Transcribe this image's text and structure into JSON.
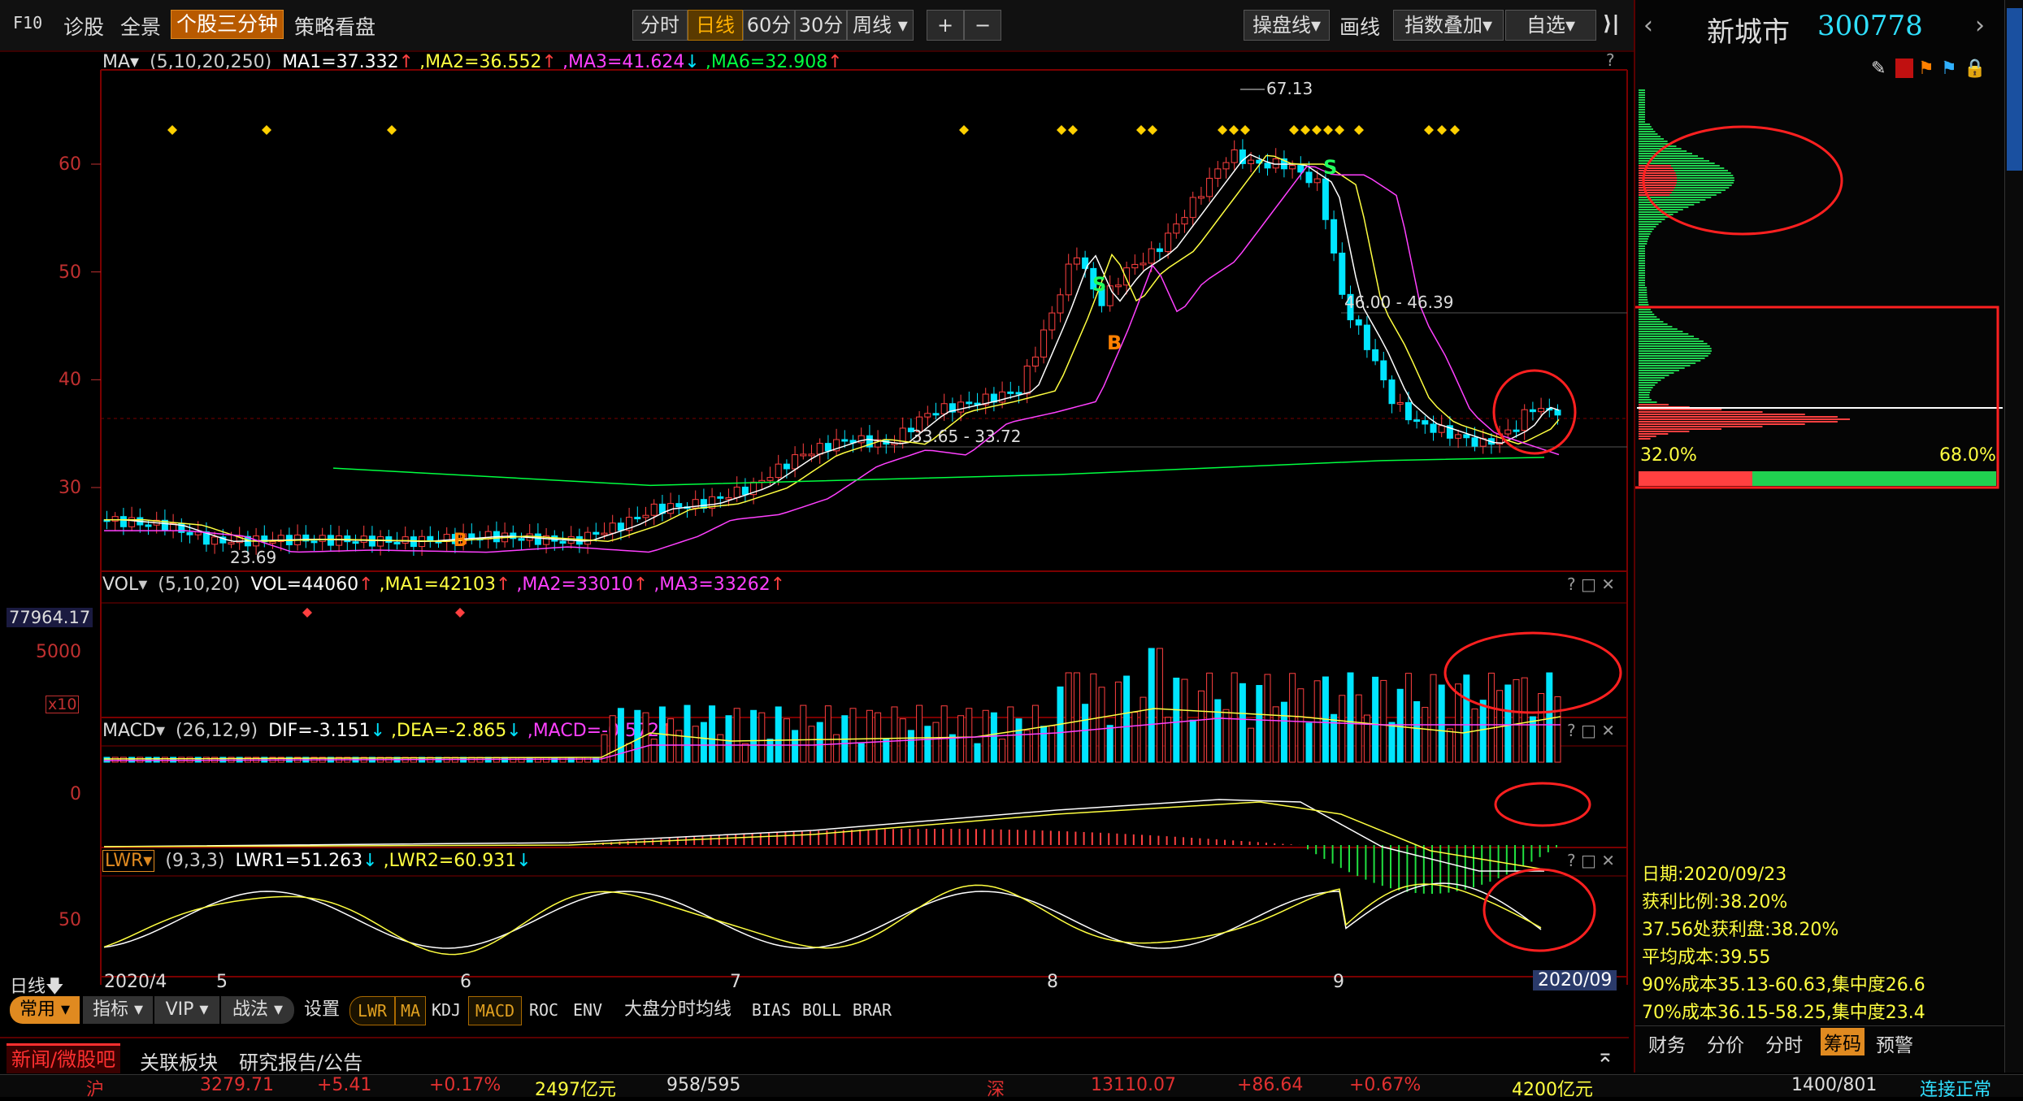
{
  "toolbar": {
    "items": [
      "F10",
      "诊股",
      "全景",
      "个股三分钟",
      "策略看盘"
    ],
    "periods": [
      "分时",
      "日线",
      "60分",
      "30分",
      "周线"
    ],
    "zoom_in": "+",
    "zoom_out": "−",
    "right_items": [
      "操盘线",
      "画线",
      "指数叠加",
      "自选"
    ],
    "expand": "⟩|"
  },
  "stock": {
    "name": "新城市",
    "code": "300778"
  },
  "ma_header": {
    "label": "MA",
    "params": "(5,10,20,250)",
    "ma1": "MA1=37.332",
    "ma2": ",MA2=36.552",
    "ma3": ",MA3=41.624",
    "ma6": ",MA6=32.908"
  },
  "price_axis": [
    "60",
    "50",
    "40",
    "30"
  ],
  "annotations": {
    "high": "67.13",
    "low": "23.69",
    "zone1": "46.00 - 46.39",
    "zone2": "33.65 - 33.72",
    "s": "S",
    "b": "B"
  },
  "vol_header": {
    "label": "VOL",
    "params": "(5,10,20)",
    "vol": "VOL=44060",
    "ma1": ",MA1=42103",
    "ma2": ",MA2=33010",
    "ma3": ",MA3=33262"
  },
  "vol_axis": {
    "max": "77964.17",
    "mid": "5000",
    "unit": "x10"
  },
  "macd_header": {
    "label": "MACD",
    "params": "(26,12,9)",
    "dif": "DIF=-3.151",
    "dea": ",DEA=-2.865",
    "macd": ",MACD=-0.572"
  },
  "macd_axis": "0",
  "lwr_header": {
    "label": "LWR",
    "params": "(9,3,3)",
    "lwr1": "LWR1=51.263",
    "lwr2": ",LWR2=60.931"
  },
  "lwr_axis": "50",
  "time_axis": {
    "period": "日线",
    "labels": [
      "2020/4",
      "5",
      "6",
      "7",
      "8",
      "9"
    ],
    "end": "2020/09"
  },
  "bottom_tabs": {
    "groups": [
      "常用",
      "指标",
      "VIP",
      "战法",
      "设置"
    ],
    "indicators": [
      "LWR",
      "MA",
      "KDJ",
      "MACD",
      "ROC",
      "ENV",
      "大盘分时均线",
      "BIAS",
      "BOLL",
      "BRAR"
    ]
  },
  "news_tabs": [
    "新闻/微股吧",
    "关联板块",
    "研究报告/公告"
  ],
  "chip": {
    "left_pct": "32.0%",
    "right_pct": "68.0%",
    "info": [
      "日期:2020/09/23",
      "获利比例:38.20%",
      "37.56处获利盘:38.20%",
      "平均成本:39.55",
      "90%成本35.13-60.63,集中度26.6",
      "70%成本36.15-58.25,集中度23.4"
    ],
    "tabs": [
      "财务",
      "分价",
      "分时",
      "筹码",
      "预警"
    ]
  },
  "status": {
    "items": [
      "沪",
      "3279.71",
      "+5.41",
      "+0.17%",
      "2497亿元",
      "958/595",
      "深",
      "13110.07",
      "+86.64",
      "+0.67%",
      "4200亿元",
      "1400/801"
    ],
    "right": "连接正常"
  },
  "colors": {
    "up": "#ff4040",
    "down": "#00e5ff",
    "ma1": "#ffffff",
    "ma2": "#ffff40",
    "ma3": "#ff40ff",
    "ma6": "#00ff40",
    "grid": "#7a0000",
    "chip_red": "#ff4040",
    "chip_green": "#20d050"
  }
}
